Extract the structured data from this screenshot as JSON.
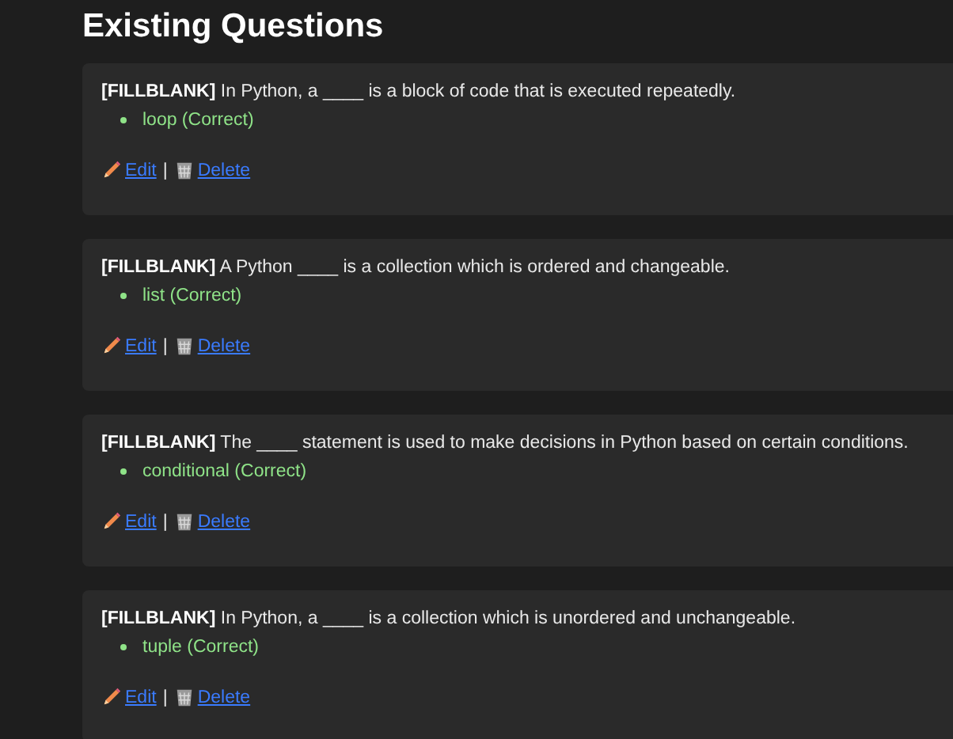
{
  "heading": "Existing Questions",
  "questions": [
    {
      "tag": "[FILLBLANK]",
      "text": "In Python, a ____ is a block of code that is executed repeatedly.",
      "answers": [
        "loop (Correct)"
      ],
      "edit": "Edit",
      "separator": "|",
      "delete": "Delete"
    },
    {
      "tag": "[FILLBLANK]",
      "text": "A Python ____ is a collection which is ordered and changeable.",
      "answers": [
        "list (Correct)"
      ],
      "edit": "Edit",
      "separator": "|",
      "delete": "Delete"
    },
    {
      "tag": "[FILLBLANK]",
      "text": "The ____ statement is used to make decisions in Python based on certain conditions.",
      "answers": [
        "conditional (Correct)"
      ],
      "edit": "Edit",
      "separator": "|",
      "delete": "Delete"
    },
    {
      "tag": "[FILLBLANK]",
      "text": "In Python, a ____ is a collection which is unordered and unchangeable.",
      "answers": [
        "tuple (Correct)"
      ],
      "edit": "Edit",
      "separator": "|",
      "delete": "Delete"
    }
  ]
}
